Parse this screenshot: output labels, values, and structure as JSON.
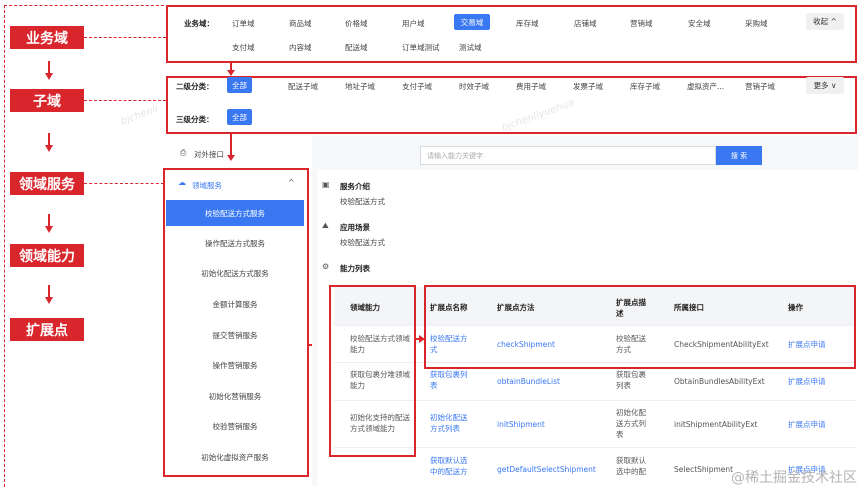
{
  "labels": [
    "业务域",
    "子域",
    "领域服务",
    "领域能力",
    "扩展点"
  ],
  "business_domain": {
    "label": "业务域：",
    "items_row1": [
      "订单域",
      "商品域",
      "价格域",
      "用户域",
      "交易域",
      "库存域",
      "店铺域",
      "营销域",
      "安全域",
      "采购域"
    ],
    "items_row2": [
      "支付域",
      "内容域",
      "配送域",
      "订单域测试",
      "测试域"
    ],
    "active": "交易域",
    "collapse_label": "收起 ^"
  },
  "sub_domain": {
    "level2_label": "二级分类：",
    "level2_items": [
      "全部",
      "配送子域",
      "地址子域",
      "支付子域",
      "时效子域",
      "费用子域",
      "发票子域",
      "库存子域",
      "虚拟资产...",
      "营销子域"
    ],
    "more_label": "更多 ∨",
    "level3_label": "三级分类：",
    "level3_items": [
      "全部"
    ]
  },
  "sidebar": {
    "external_interface": "对外接口",
    "group_label": "领域服务",
    "items": [
      "校验配送方式服务",
      "操作配送方式服务",
      "初始化配送方式服务",
      "金额计算服务",
      "提交营销服务",
      "操作营销服务",
      "初始化营销服务",
      "校验营销服务",
      "初始化虚拟资产服务"
    ],
    "active_index": 0
  },
  "search": {
    "placeholder": "请输入能力关键字",
    "button": "搜 索"
  },
  "service_intro": {
    "title": "服务介绍",
    "value": "校验配送方式"
  },
  "scenario": {
    "title": "应用场景",
    "value": "校验配送方式"
  },
  "capability_list": {
    "title": "能力列表",
    "columns": [
      "领域能力",
      "扩展点名称",
      "扩展点方法",
      "扩展点描述",
      "所属接口",
      "操作"
    ],
    "rows": [
      {
        "capability": "校验配送方式领域能力",
        "ext_name": "校验配送方式",
        "method": "checkShipment",
        "desc": "校验配送方式",
        "interface": "CheckShipmentAbilityExt",
        "action": "扩展点申请"
      },
      {
        "capability": "获取包裹分堆领域能力",
        "ext_name": "获取包裹列表",
        "method": "obtainBundleList",
        "desc": "获取包裹列表",
        "interface": "ObtainBundlesAbilityExt",
        "action": "扩展点申请"
      },
      {
        "capability": "初始化支持的配送方式领域能力",
        "ext_name": "初始化配送方式列表",
        "method": "initShipment",
        "desc": "初始化配送方式列表",
        "interface": "initShipmentAbilityExt",
        "action": "扩展点申请"
      },
      {
        "capability": "",
        "ext_name": "获取默认选中的配送方",
        "method": "getDefaultSelectShipment",
        "desc": "获取默认选中的配",
        "interface": "SelectShipment",
        "action": "扩展点申请"
      }
    ]
  },
  "footer_watermark": "@稀土掘金技术社区",
  "colors": {
    "accent": "#3a78f2",
    "red": "#d9262c"
  }
}
